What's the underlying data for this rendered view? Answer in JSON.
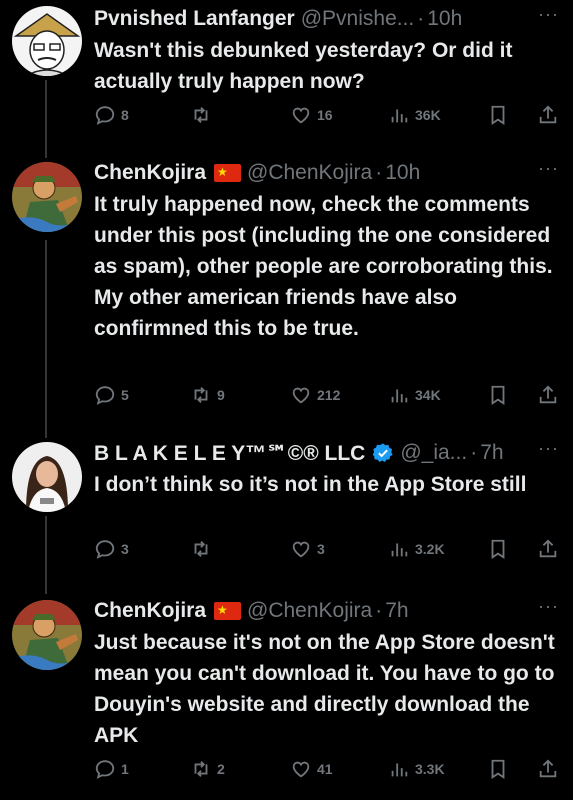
{
  "tweets": [
    {
      "name": "Pvnished Lanfanger",
      "handle": "@Pvnishe...",
      "time": "10h",
      "text": "Wasn't this debunked yesterday? Or did it actually truly happen now?",
      "replies": "8",
      "retweets": "",
      "likes": "16",
      "views": "36K"
    },
    {
      "name": "ChenKojira",
      "handle": "@ChenKojira",
      "time": "10h",
      "text": "It truly happened now, check the comments under this post (including the one considered as spam), other people are corroborating this. My other american friends have also confirmned this to be true.",
      "replies": "5",
      "retweets": "9",
      "likes": "212",
      "views": "34K"
    },
    {
      "name": "B L A K E L E Y™℠©® LLC",
      "handle": "@_ia...",
      "time": "7h",
      "text": "I don’t think so it’s not in the App Store still",
      "replies": "3",
      "retweets": "",
      "likes": "3",
      "views": "3.2K"
    },
    {
      "name": "ChenKojira",
      "handle": "@ChenKojira",
      "time": "7h",
      "text": "Just because it's not on the App Store doesn't mean you can't download it. You have to go to Douyin's website and directly download the APK",
      "replies": "1",
      "retweets": "2",
      "likes": "41",
      "views": "3.3K"
    }
  ],
  "separator": "·",
  "more_glyph": "···",
  "colors": {
    "background": "#000000",
    "text_primary": "#e7e9ea",
    "text_secondary": "#71767b",
    "verified_blue": "#1d9bf0",
    "flag_red": "#de2910",
    "flag_star": "#ffde00"
  }
}
